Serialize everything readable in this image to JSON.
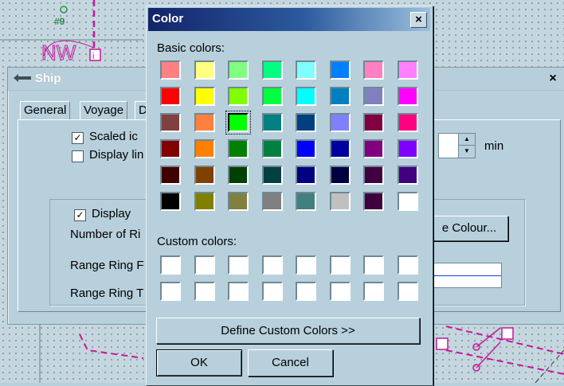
{
  "background_chart": {
    "marker_label": "#9"
  },
  "ship_window": {
    "title": "Ship",
    "close_glyph": "×",
    "tabs": [
      "General",
      "Voyage",
      "D"
    ],
    "scaled_icon_label": "Scaled ic",
    "scaled_icon_checked": true,
    "display_lines_label": "Display lin",
    "display_lines_checked": false,
    "display_label": "Display",
    "display_checked": true,
    "number_of_rings_label": "Number of Ri",
    "range_ring_1_label": "Range Ring F",
    "range_ring_2_label": "Range Ring T",
    "min_label": "min",
    "colour_button_label": "e Colour...",
    "line_color": "#1e3ecc"
  },
  "color_dialog": {
    "title": "Color",
    "close_glyph": "×",
    "basic_colors_label": "Basic colors:",
    "custom_colors_label": "Custom colors:",
    "basic_colors": [
      [
        "#ff8080",
        "#ffff80",
        "#80ff80",
        "#00ff80",
        "#80ffff",
        "#0080ff",
        "#ff80c0",
        "#ff80ff"
      ],
      [
        "#ff0000",
        "#ffff00",
        "#80ff00",
        "#00ff40",
        "#00ffff",
        "#0080c0",
        "#8080c0",
        "#ff00ff"
      ],
      [
        "#804040",
        "#ff8040",
        "#00ff00",
        "#008080",
        "#004080",
        "#8080ff",
        "#800040",
        "#ff0080"
      ],
      [
        "#800000",
        "#ff8000",
        "#008000",
        "#008040",
        "#0000ff",
        "#0000a0",
        "#800080",
        "#8000ff"
      ],
      [
        "#400000",
        "#804000",
        "#004000",
        "#004040",
        "#000080",
        "#000040",
        "#400040",
        "#400080"
      ],
      [
        "#000000",
        "#808000",
        "#808040",
        "#808080",
        "#408080",
        "#c0c0c0",
        "#400040",
        "#ffffff"
      ]
    ],
    "selected_color": "#00ff00",
    "custom_colors": [
      [
        "#ffffff",
        "#ffffff",
        "#ffffff",
        "#ffffff",
        "#ffffff",
        "#ffffff",
        "#ffffff",
        "#ffffff"
      ],
      [
        "#ffffff",
        "#ffffff",
        "#ffffff",
        "#ffffff",
        "#ffffff",
        "#ffffff",
        "#ffffff",
        "#ffffff"
      ]
    ],
    "define_custom_label": "Define Custom Colors >>",
    "ok_label": "OK",
    "cancel_label": "Cancel"
  }
}
